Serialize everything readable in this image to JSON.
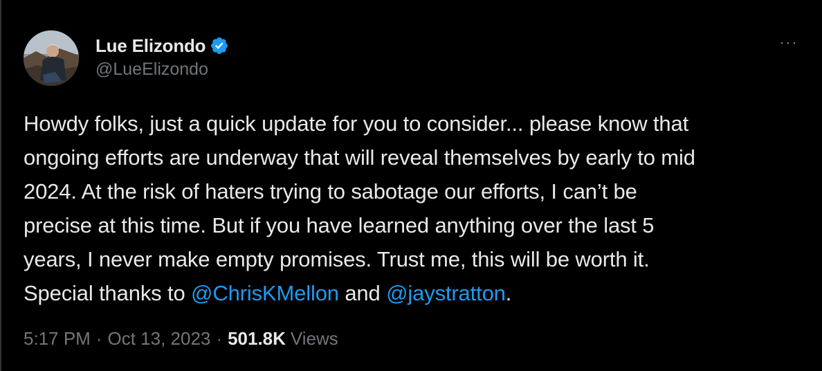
{
  "author": {
    "display_name": "Lue Elizondo",
    "handle": "@LueElizondo",
    "verified_icon": "verified-badge-icon"
  },
  "more_menu_label": "···",
  "tweet": {
    "lines": [
      {
        "text": "Howdy folks, just a quick update for you to consider... please know that"
      },
      {
        "text": "ongoing efforts are underway that will reveal themselves by early to mid"
      },
      {
        "text": "2024. At the risk of haters trying to sabotage our efforts, I can’t be"
      },
      {
        "text": "precise at this time. But if you have learned anything over the last 5"
      },
      {
        "text": "years, I never make empty promises. Trust me, this will be worth it."
      }
    ],
    "last_line": {
      "prefix": "Special thanks to ",
      "mention_1": "@ChrisKMellon",
      "middle": " and ",
      "mention_2": "@jaystratton",
      "suffix": "."
    }
  },
  "meta": {
    "time": "5:17 PM",
    "separator": "·",
    "date": "Oct 13, 2023",
    "views_count": "501.8K",
    "views_label": "Views"
  },
  "colors": {
    "background": "#000000",
    "text": "#e7e9ea",
    "secondary": "#71767b",
    "mention": "#1d9bf0",
    "verified": "#1d9bf0"
  }
}
